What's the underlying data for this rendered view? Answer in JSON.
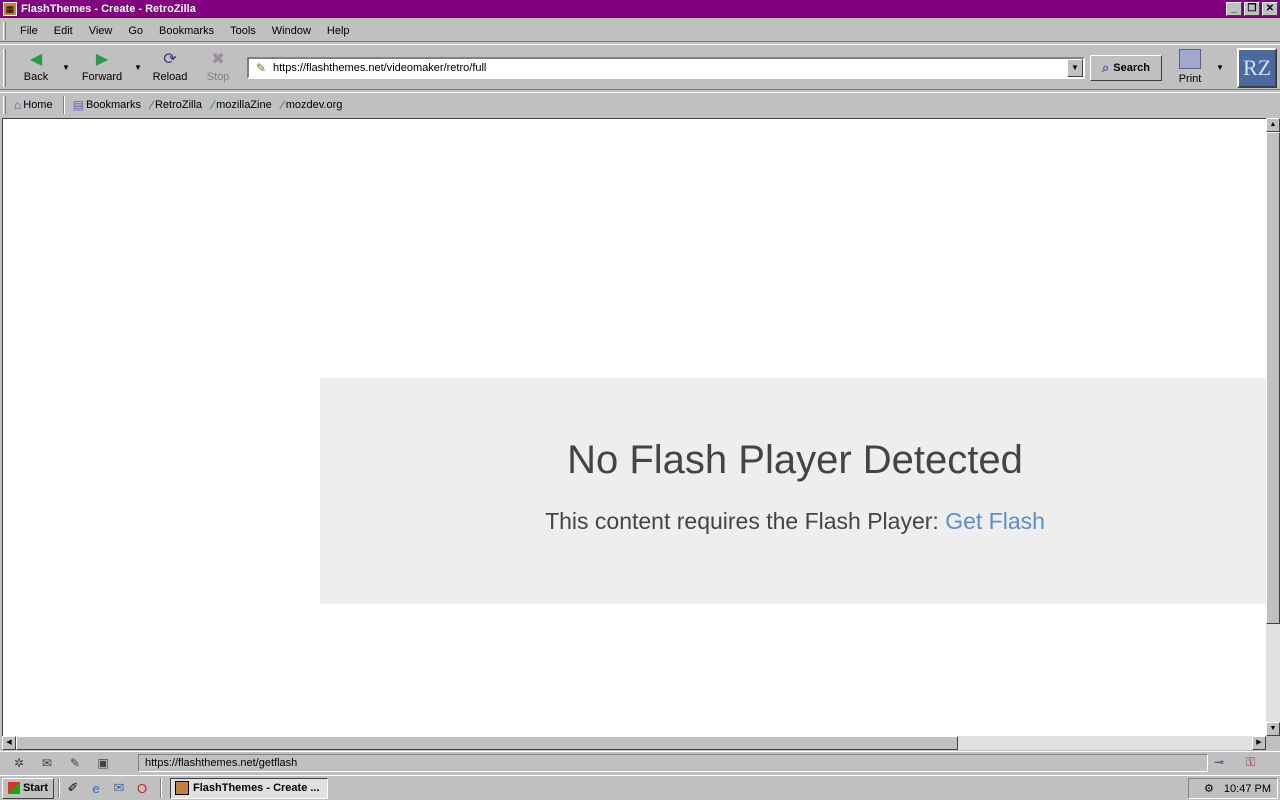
{
  "window": {
    "title": "FlashThemes - Create - RetroZilla",
    "buttons": {
      "minimize": "_",
      "maximize": "❐",
      "close": "✕"
    }
  },
  "menubar": {
    "items": [
      "File",
      "Edit",
      "View",
      "Go",
      "Bookmarks",
      "Tools",
      "Window",
      "Help"
    ]
  },
  "navbar": {
    "back": "Back",
    "forward": "Forward",
    "reload": "Reload",
    "stop": "Stop",
    "url": "https://flashthemes.net/videomaker/retro/full",
    "search": "Search",
    "print": "Print",
    "logo": "RZ"
  },
  "personalbar": {
    "items": [
      "Home",
      "Bookmarks",
      "RetroZilla",
      "mozillaZine",
      "mozdev.org"
    ]
  },
  "page": {
    "flash_title": "No Flash Player Detected",
    "flash_message": "This content requires the Flash Player:",
    "flash_link": "Get Flash",
    "link_color": "#5a90c8",
    "box_color": "#eeeeee"
  },
  "statusbar": {
    "text": "https://flashthemes.net/getflash"
  },
  "taskbar": {
    "start": "Start",
    "task_title": "FlashThemes - Create ...",
    "clock": "10:47 PM"
  },
  "colors": {
    "titlebar": "#800080",
    "chrome": "#c0c0c0"
  }
}
